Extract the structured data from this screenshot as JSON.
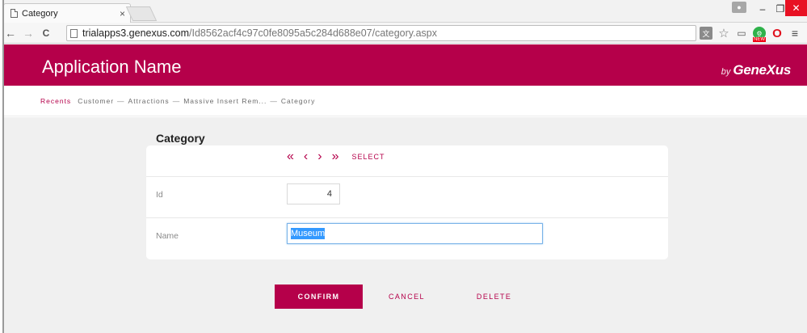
{
  "browser": {
    "tab_title": "Category",
    "tab_close": "×",
    "url_host": "trialapps3.genexus.com",
    "url_path": "/Id8562acf4c97c0fe8095a5c284d688e07/category.aspx",
    "nav_back": "←",
    "nav_forward": "→",
    "nav_reload": "C",
    "window_min": "–",
    "window_max": "❐",
    "window_close": "✕",
    "ext_translate": "文",
    "ext_star": "☆",
    "ext_cast": "▭",
    "ext_opera": "O",
    "ext_menu": "≡"
  },
  "header": {
    "app_name": "Application Name",
    "brand_by": "by",
    "brand_name": "GeneXus"
  },
  "breadcrumb": {
    "recents": "Recents",
    "items": [
      "Customer",
      "Attractions",
      "Massive Insert Rem...",
      "Category"
    ],
    "separator": "—"
  },
  "form": {
    "title": "Category",
    "pager": {
      "first": "«",
      "prev": "‹",
      "next": "›",
      "last": "»",
      "select": "SELECT"
    },
    "fields": {
      "id_label": "Id",
      "id_value": "4",
      "name_label": "Name",
      "name_value": "Museum"
    }
  },
  "actions": {
    "confirm": "CONFIRM",
    "cancel": "CANCEL",
    "delete": "DELETE"
  },
  "colors": {
    "brand": "#b5004a",
    "page_bg": "#f0f0f0"
  }
}
